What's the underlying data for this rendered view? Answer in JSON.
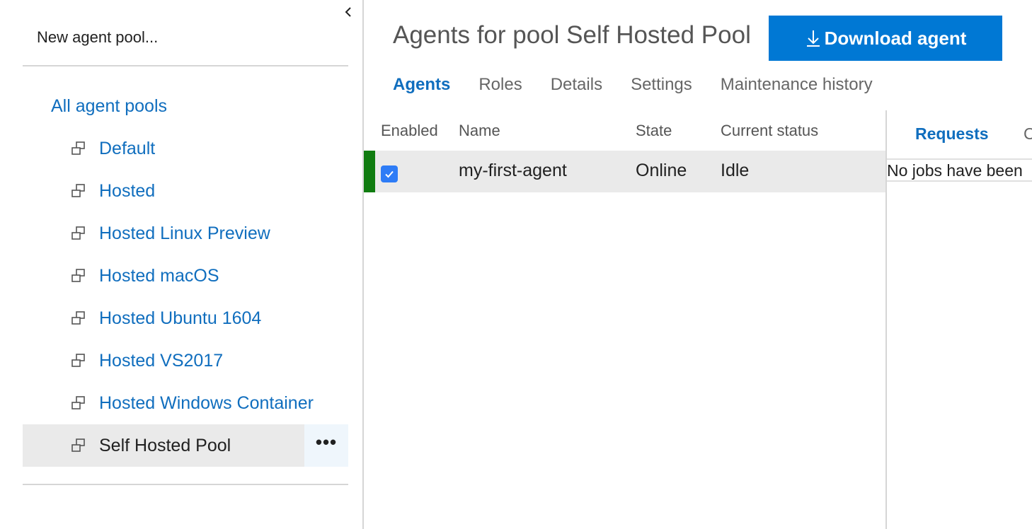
{
  "sidebar": {
    "new_pool_label": "New agent pool...",
    "all_pools_label": "All agent pools",
    "pools": [
      {
        "label": "Default",
        "icon": "pool-icon"
      },
      {
        "label": "Hosted",
        "icon": "pool-icon"
      },
      {
        "label": "Hosted Linux Preview",
        "icon": "pool-icon"
      },
      {
        "label": "Hosted macOS",
        "icon": "pool-icon"
      },
      {
        "label": "Hosted Ubuntu 1604",
        "icon": "pool-icon"
      },
      {
        "label": "Hosted VS2017",
        "icon": "pool-icon"
      },
      {
        "label": "Hosted Windows Container",
        "icon": "pool-icon"
      },
      {
        "label": "Self Hosted Pool",
        "icon": "pool-icon",
        "selected": true
      }
    ],
    "more_label": "•••"
  },
  "header": {
    "title": "Agents for pool Self Hosted Pool",
    "download_label": "Download agent"
  },
  "tabs": [
    {
      "label": "Agents",
      "active": true
    },
    {
      "label": "Roles"
    },
    {
      "label": "Details"
    },
    {
      "label": "Settings"
    },
    {
      "label": "Maintenance history"
    }
  ],
  "grid": {
    "columns": [
      "Enabled",
      "Name",
      "State",
      "Current status"
    ],
    "rows": [
      {
        "enabled": true,
        "name": "my-first-agent",
        "state": "Online",
        "status": "Idle"
      }
    ]
  },
  "details_pane": {
    "tabs": [
      {
        "label": "Requests",
        "active": true
      },
      {
        "label": "C"
      }
    ],
    "message": "No jobs have been"
  },
  "colors": {
    "accent": "#0078d4",
    "link": "#106ebe",
    "online": "#107c10",
    "selected_bg": "#eaeaea"
  }
}
